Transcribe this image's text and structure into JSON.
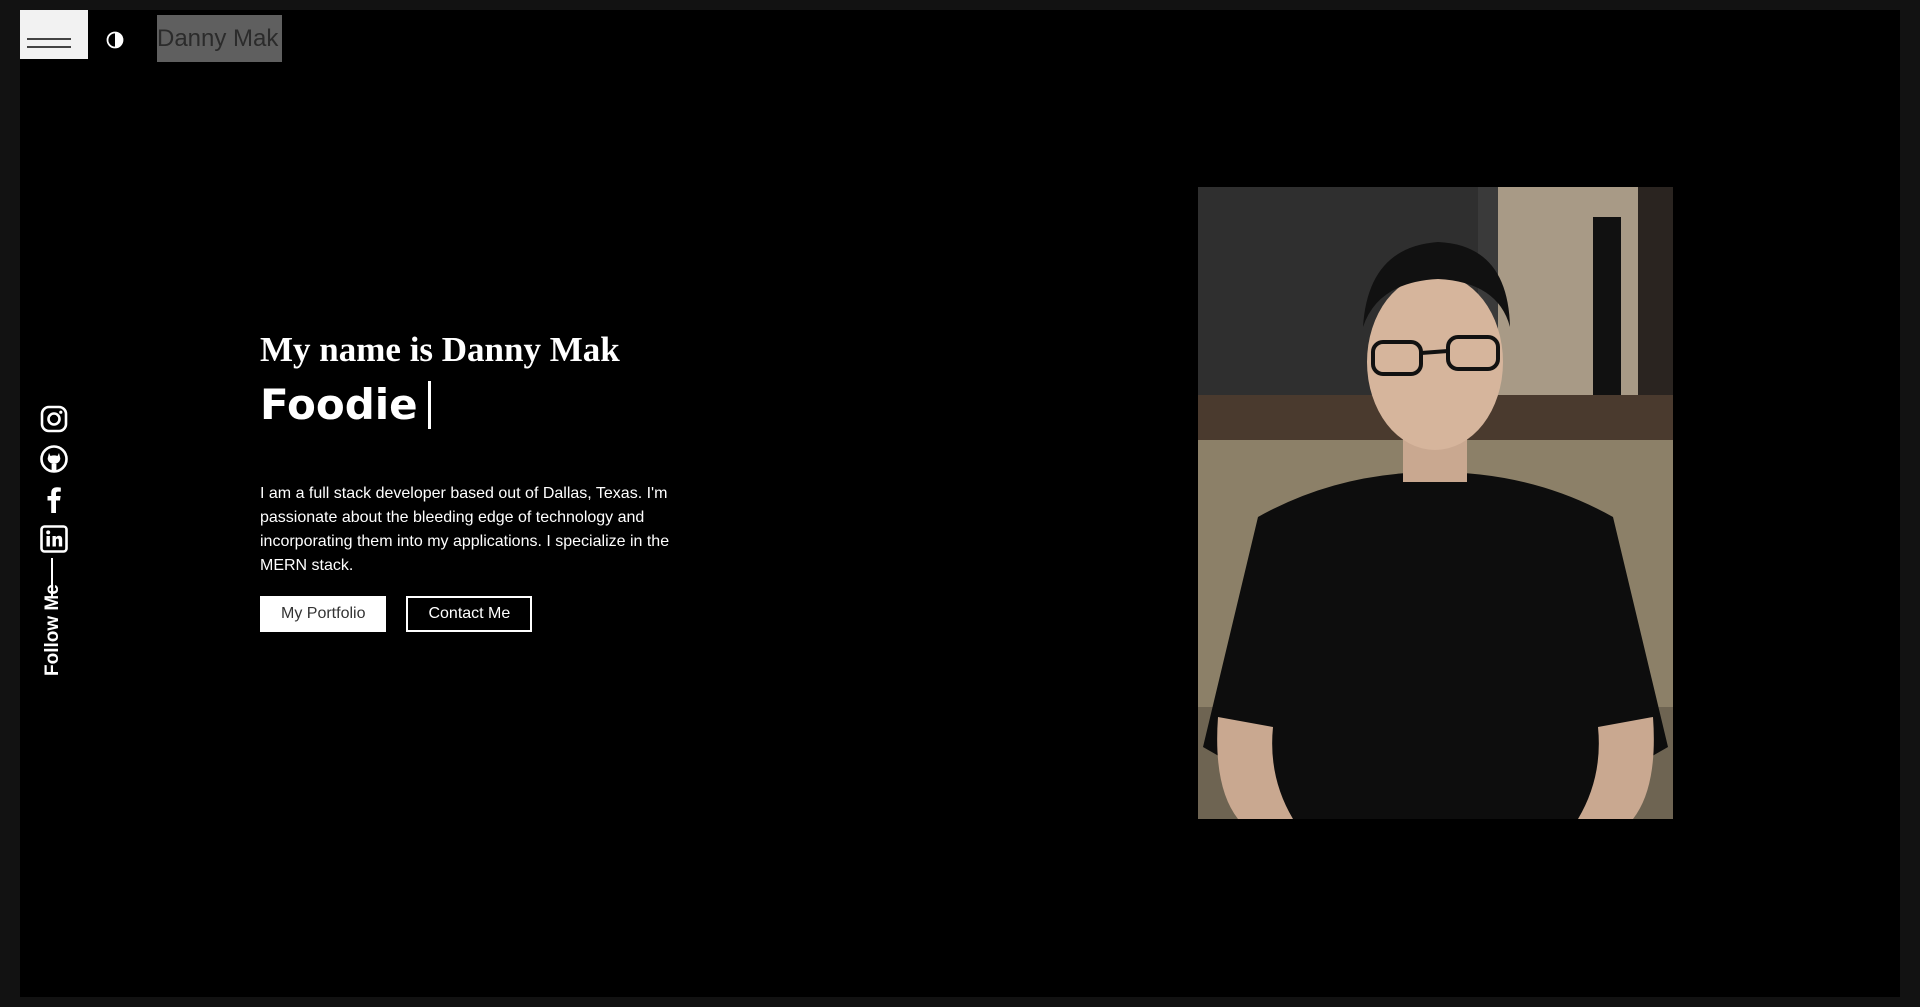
{
  "header": {
    "brand": "Danny Mak",
    "menu_icon": "hamburger-icon",
    "theme_icon": "contrast-icon"
  },
  "social": {
    "follow_label": "Follow Me",
    "icons": [
      "instagram-icon",
      "github-icon",
      "facebook-icon",
      "linkedin-icon"
    ]
  },
  "hero": {
    "intro": "My name is Danny Mak",
    "role": "Foodie",
    "bio": "I am a full stack developer based out of Dallas, Texas. I'm passionate about the bleeding edge of technology and incorporating them into my applications. I specialize in the MERN stack.",
    "portfolio_label": "My Portfolio",
    "contact_label": "Contact Me"
  },
  "colors": {
    "background": "#000000",
    "outer": "#121212",
    "text": "#ffffff",
    "brand_bg": "#5f5f5f"
  }
}
